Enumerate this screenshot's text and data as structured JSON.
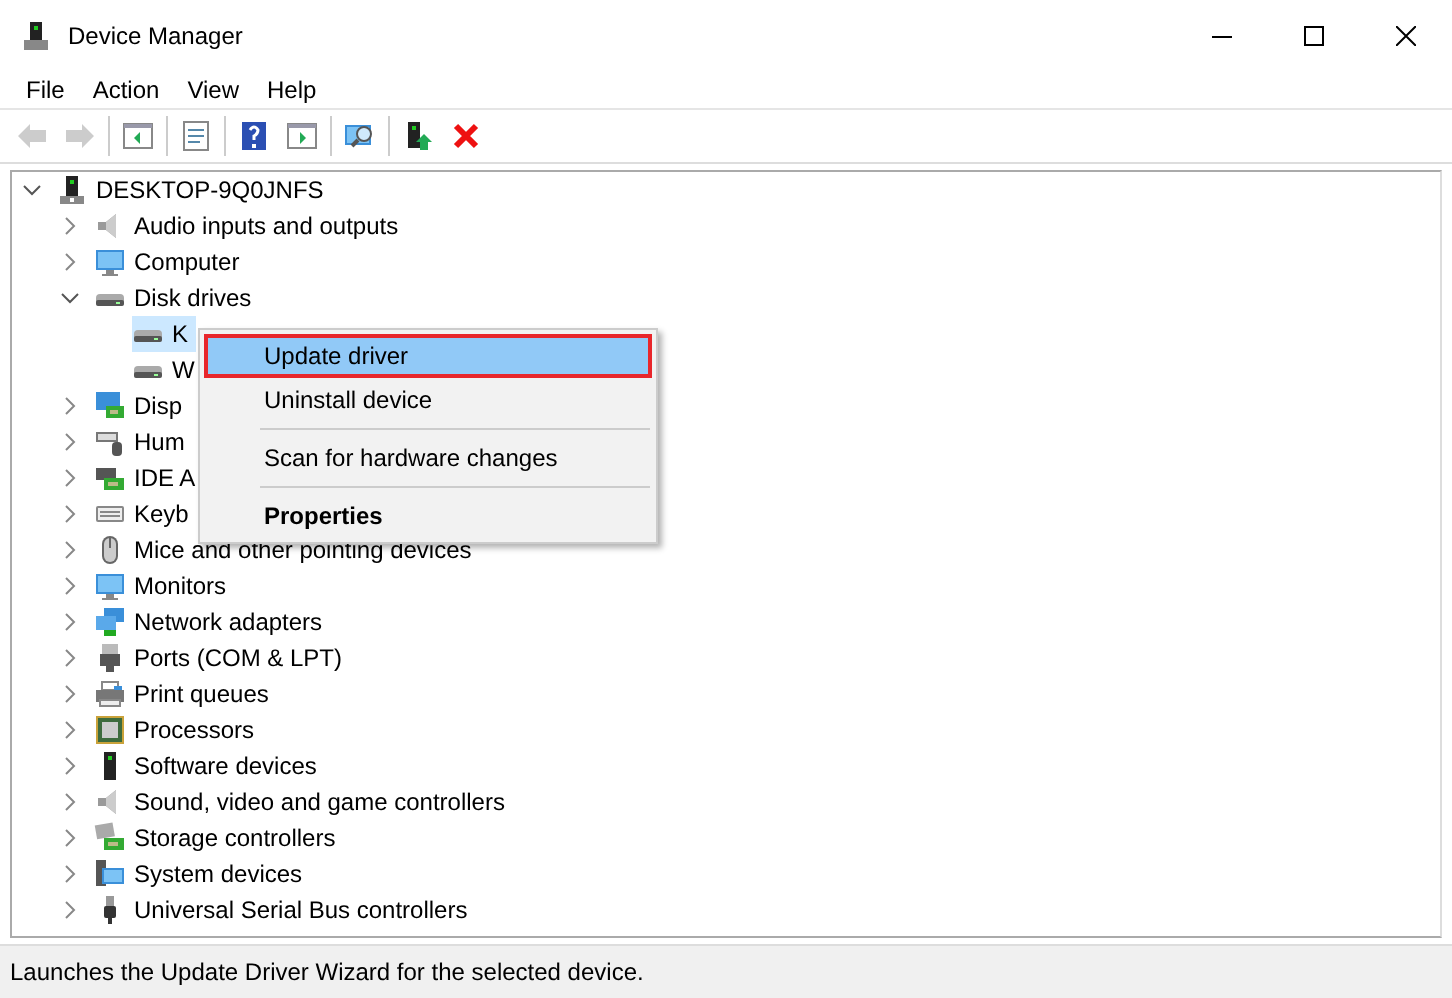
{
  "window": {
    "title": "Device Manager"
  },
  "menu_bar": [
    "File",
    "Action",
    "View",
    "Help"
  ],
  "toolbar": [
    {
      "disabled": true
    },
    {
      "disabled": true
    },
    {
      "disabled": false
    },
    {
      "disabled": false
    },
    {
      "disabled": false
    },
    {
      "disabled": false
    },
    {
      "disabled": false
    },
    {
      "disabled": false
    },
    {
      "disabled": false
    }
  ],
  "tree": [
    {
      "label": "DESKTOP-9Q0JNFS",
      "expanded": true,
      "selected": false,
      "children": [
        {
          "label": "Audio inputs and outputs",
          "expanded": false,
          "selected": false
        },
        {
          "label": "Computer",
          "expanded": false,
          "selected": false
        },
        {
          "label": "Disk drives",
          "expanded": true,
          "selected": false,
          "children": [
            {
              "label": "K",
              "selected": true
            },
            {
              "label": "W",
              "selected": false
            }
          ]
        },
        {
          "label": "Disp",
          "expanded": false,
          "selected": false
        },
        {
          "label": "Hum",
          "expanded": false,
          "selected": false
        },
        {
          "label": "IDE A",
          "expanded": false,
          "selected": false
        },
        {
          "label": "Keyb",
          "expanded": false,
          "selected": false
        },
        {
          "label": "Mice and other pointing devices",
          "expanded": false,
          "selected": false
        },
        {
          "label": "Monitors",
          "expanded": false,
          "selected": false
        },
        {
          "label": "Network adapters",
          "expanded": false,
          "selected": false
        },
        {
          "label": "Ports (COM & LPT)",
          "expanded": false,
          "selected": false
        },
        {
          "label": "Print queues",
          "expanded": false,
          "selected": false
        },
        {
          "label": "Processors",
          "expanded": false,
          "selected": false
        },
        {
          "label": "Software devices",
          "expanded": false,
          "selected": false
        },
        {
          "label": "Sound, video and game controllers",
          "expanded": false,
          "selected": false
        },
        {
          "label": "Storage controllers",
          "expanded": false,
          "selected": false
        },
        {
          "label": "System devices",
          "expanded": false,
          "selected": false
        },
        {
          "label": "Universal Serial Bus controllers",
          "expanded": false,
          "selected": false
        }
      ]
    }
  ],
  "context_menu": [
    {
      "label": "Update driver",
      "selected": true,
      "bold": false
    },
    {
      "label": "Uninstall device",
      "selected": false,
      "bold": false
    },
    {
      "kind": "separator"
    },
    {
      "label": "Scan for hardware changes",
      "selected": false,
      "bold": false
    },
    {
      "kind": "separator"
    },
    {
      "label": "Properties",
      "selected": false,
      "bold": true
    }
  ],
  "status_bar": "Launches the Update Driver Wizard for the selected device."
}
